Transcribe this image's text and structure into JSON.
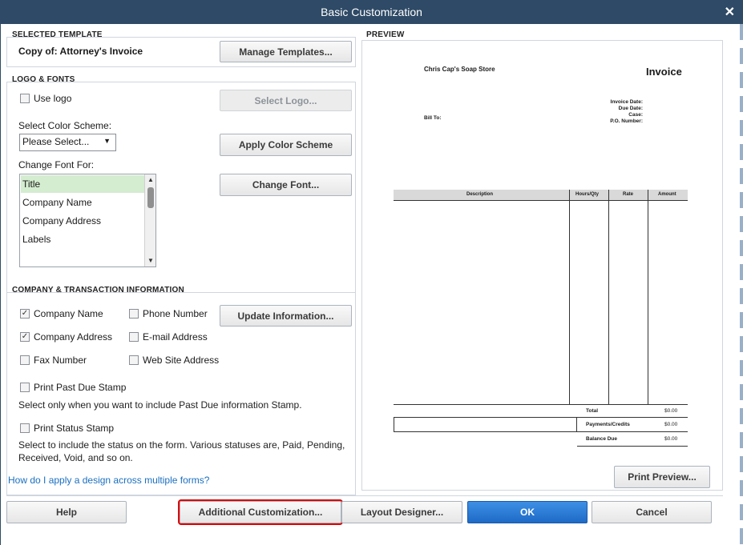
{
  "window": {
    "title": "Basic Customization",
    "close_glyph": "✕"
  },
  "selected_template": {
    "heading": "SELECTED TEMPLATE",
    "value": "Copy of: Attorney's Invoice",
    "manage_button": "Manage Templates..."
  },
  "logo_fonts": {
    "heading": "LOGO & FONTS",
    "use_logo_label": "Use logo",
    "use_logo_checked": false,
    "select_logo_button": "Select Logo...",
    "color_scheme_label": "Select Color Scheme:",
    "color_scheme_value": "Please Select...",
    "apply_color_button": "Apply Color Scheme",
    "change_font_label": "Change Font For:",
    "font_items": [
      "Title",
      "Company Name",
      "Company Address",
      "Labels"
    ],
    "selected_font_item": "Title",
    "change_font_button": "Change Font..."
  },
  "company_info": {
    "heading": "COMPANY & TRANSACTION INFORMATION",
    "checkboxes": [
      {
        "label": "Company Name",
        "checked": true
      },
      {
        "label": "Phone Number",
        "checked": false
      },
      {
        "label": "Company Address",
        "checked": true
      },
      {
        "label": "E-mail Address",
        "checked": false
      },
      {
        "label": "Fax Number",
        "checked": false
      },
      {
        "label": "Web Site Address",
        "checked": false
      }
    ],
    "update_button": "Update Information...",
    "past_due_label": "Print Past Due Stamp",
    "past_due_note": "Select only when you want to include Past Due information Stamp.",
    "status_label": "Print Status Stamp",
    "status_note": "Select to include the status on the form. Various statuses are, Paid, Pending, Received, Void, and so on."
  },
  "help_link": "How do I apply a design across multiple forms?",
  "preview": {
    "heading": "PREVIEW",
    "company": "Chris Cap's Soap Store",
    "doc_title": "Invoice",
    "date_labels": [
      "Invoice Date:",
      "Due Date:",
      "Case:",
      "P.O. Number:"
    ],
    "bill_to": "Bill To:",
    "columns": [
      "Description",
      "Hours/Qty",
      "Rate",
      "Amount"
    ],
    "totals": [
      {
        "label": "Total",
        "value": "$0.00"
      },
      {
        "label": "Payments/Credits",
        "value": "$0.00"
      },
      {
        "label": "Balance Due",
        "value": "$0.00"
      }
    ],
    "print_preview_button": "Print Preview..."
  },
  "footer": {
    "help": "Help",
    "additional": "Additional Customization...",
    "layout": "Layout Designer...",
    "ok": "OK",
    "cancel": "Cancel"
  },
  "colors": {
    "titlebar": "#2e4a66",
    "primary": "#1e6ac7",
    "highlight": "#e00000",
    "selection": "#d4ecd0"
  }
}
